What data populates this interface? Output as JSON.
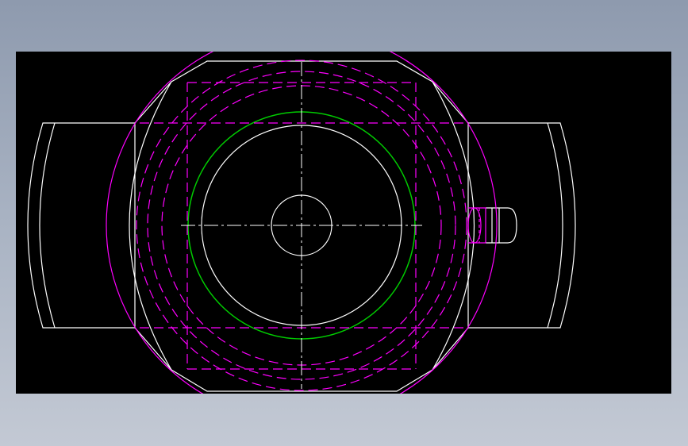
{
  "colors": {
    "background_gradient_top": "#8e9aae",
    "background_gradient_bottom": "#c3c9d4",
    "viewport": "#000000",
    "outline": "#ffffff",
    "hidden_lines": "#ff00ff",
    "bore_circle": "#00cc00"
  },
  "drawing": {
    "type": "cad-2d-view",
    "layers": [
      "outline",
      "hidden-dashed",
      "centerlines",
      "bore"
    ]
  }
}
